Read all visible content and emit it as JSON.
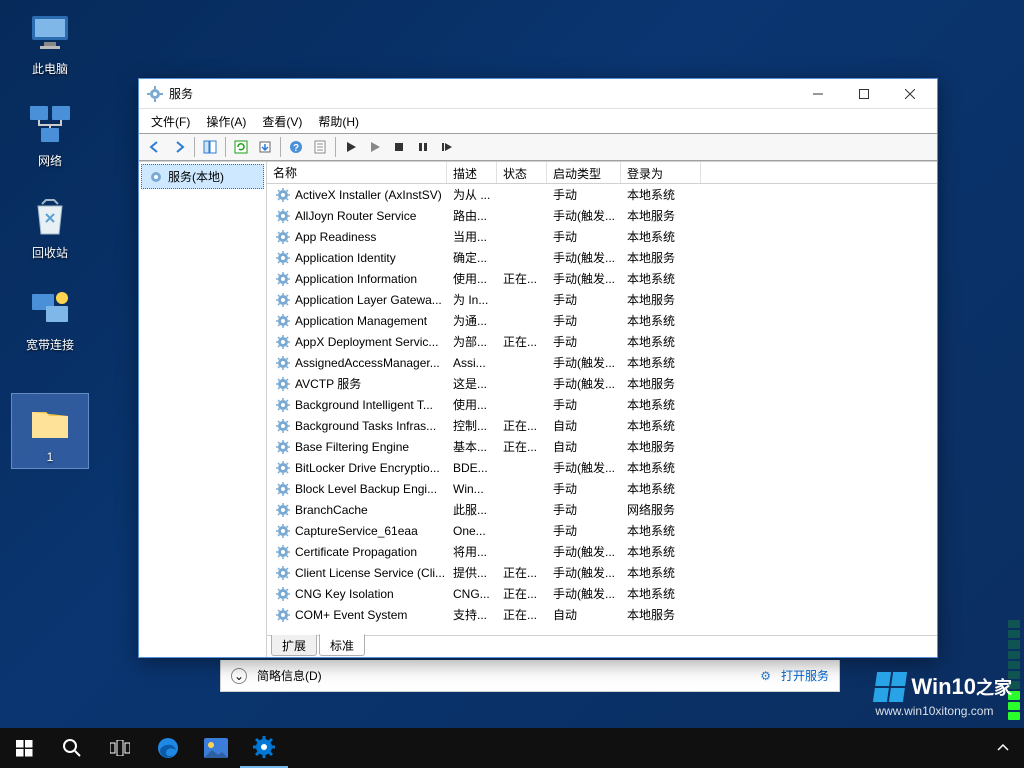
{
  "desktop": {
    "icons": [
      {
        "label": "此电脑"
      },
      {
        "label": "网络"
      },
      {
        "label": "回收站"
      },
      {
        "label": "宽带连接"
      },
      {
        "label": "1"
      }
    ]
  },
  "window": {
    "title": "服务",
    "menu": [
      "文件(F)",
      "操作(A)",
      "查看(V)",
      "帮助(H)"
    ],
    "tree_node": "服务(本地)",
    "columns": {
      "name": "名称",
      "desc": "描述",
      "state": "状态",
      "start": "启动类型",
      "logon": "登录为"
    },
    "tabs": {
      "extended": "扩展",
      "standard": "标准"
    },
    "services": [
      {
        "name": "ActiveX Installer (AxInstSV)",
        "desc": "为从 ...",
        "state": "",
        "start": "手动",
        "logon": "本地系统"
      },
      {
        "name": "AllJoyn Router Service",
        "desc": "路由...",
        "state": "",
        "start": "手动(触发...",
        "logon": "本地服务"
      },
      {
        "name": "App Readiness",
        "desc": "当用...",
        "state": "",
        "start": "手动",
        "logon": "本地系统"
      },
      {
        "name": "Application Identity",
        "desc": "确定...",
        "state": "",
        "start": "手动(触发...",
        "logon": "本地服务"
      },
      {
        "name": "Application Information",
        "desc": "使用...",
        "state": "正在...",
        "start": "手动(触发...",
        "logon": "本地系统"
      },
      {
        "name": "Application Layer Gatewa...",
        "desc": "为 In...",
        "state": "",
        "start": "手动",
        "logon": "本地服务"
      },
      {
        "name": "Application Management",
        "desc": "为通...",
        "state": "",
        "start": "手动",
        "logon": "本地系统"
      },
      {
        "name": "AppX Deployment Servic...",
        "desc": "为部...",
        "state": "正在...",
        "start": "手动",
        "logon": "本地系统"
      },
      {
        "name": "AssignedAccessManager...",
        "desc": "Assi...",
        "state": "",
        "start": "手动(触发...",
        "logon": "本地系统"
      },
      {
        "name": "AVCTP 服务",
        "desc": "这是...",
        "state": "",
        "start": "手动(触发...",
        "logon": "本地服务"
      },
      {
        "name": "Background Intelligent T...",
        "desc": "使用...",
        "state": "",
        "start": "手动",
        "logon": "本地系统"
      },
      {
        "name": "Background Tasks Infras...",
        "desc": "控制...",
        "state": "正在...",
        "start": "自动",
        "logon": "本地系统"
      },
      {
        "name": "Base Filtering Engine",
        "desc": "基本...",
        "state": "正在...",
        "start": "自动",
        "logon": "本地服务"
      },
      {
        "name": "BitLocker Drive Encryptio...",
        "desc": "BDE...",
        "state": "",
        "start": "手动(触发...",
        "logon": "本地系统"
      },
      {
        "name": "Block Level Backup Engi...",
        "desc": "Win...",
        "state": "",
        "start": "手动",
        "logon": "本地系统"
      },
      {
        "name": "BranchCache",
        "desc": "此服...",
        "state": "",
        "start": "手动",
        "logon": "网络服务"
      },
      {
        "name": "CaptureService_61eaa",
        "desc": "One...",
        "state": "",
        "start": "手动",
        "logon": "本地系统"
      },
      {
        "name": "Certificate Propagation",
        "desc": "将用...",
        "state": "",
        "start": "手动(触发...",
        "logon": "本地系统"
      },
      {
        "name": "Client License Service (Cli...",
        "desc": "提供...",
        "state": "正在...",
        "start": "手动(触发...",
        "logon": "本地系统"
      },
      {
        "name": "CNG Key Isolation",
        "desc": "CNG...",
        "state": "正在...",
        "start": "手动(触发...",
        "logon": "本地系统"
      },
      {
        "name": "COM+ Event System",
        "desc": "支持...",
        "state": "正在...",
        "start": "自动",
        "logon": "本地服务"
      }
    ]
  },
  "under": {
    "label": "简略信息(D)",
    "link": "打开服务"
  },
  "watermark": {
    "brand": "Win10",
    "suffix": "之家",
    "url": "www.win10xitong.com"
  }
}
